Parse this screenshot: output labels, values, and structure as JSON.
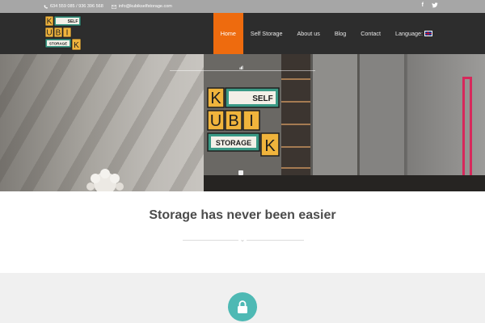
{
  "topbar": {
    "phone": "634 559 085 / 936 396 568",
    "email": "info@kubikselfstorage.com",
    "social": [
      "facebook-icon",
      "twitter-icon"
    ]
  },
  "logo": {
    "letters": [
      "K",
      "U",
      "B",
      "I",
      "K"
    ],
    "self": "SELF",
    "storage": "STORAGE"
  },
  "nav": {
    "items": [
      {
        "label": "Home",
        "active": true
      },
      {
        "label": "Self Storage"
      },
      {
        "label": "About us"
      },
      {
        "label": "Blog"
      },
      {
        "label": "Contact"
      },
      {
        "label": "Language:"
      }
    ]
  },
  "main": {
    "tagline": "Storage has never been easier",
    "section_icon": "lock-icon"
  },
  "colors": {
    "accent": "#ee6b0e",
    "header_bg": "#2d2d2d",
    "topbar_bg": "#a6a6a6",
    "teal": "#4eb9b4",
    "logo_yellow": "#f0b43c",
    "logo_green": "#3a9a86"
  }
}
